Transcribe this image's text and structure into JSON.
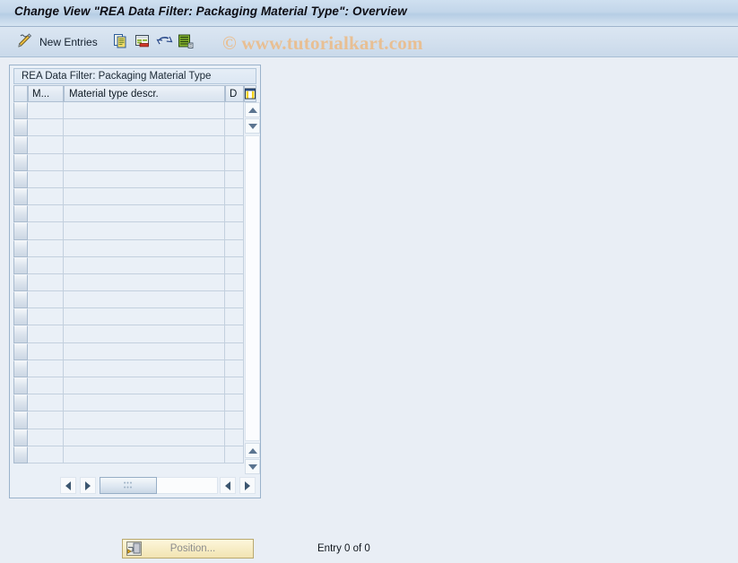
{
  "window": {
    "title": "Change View \"REA Data Filter: Packaging Material Type\": Overview"
  },
  "toolbar": {
    "edit_icon": "pencil-icon",
    "new_entries_label": "New Entries",
    "buttons": [
      {
        "name": "copy-as-button",
        "icon": "copy-icon"
      },
      {
        "name": "delete-button",
        "icon": "delete-row-icon"
      },
      {
        "name": "undo-button",
        "icon": "undo-icon"
      },
      {
        "name": "select-all-button",
        "icon": "details-icon"
      }
    ]
  },
  "watermark": {
    "text": "© www.tutorialkart.com",
    "color": "#e8bf93"
  },
  "panel": {
    "caption": "REA Data Filter: Packaging Material Type"
  },
  "grid": {
    "columns": [
      {
        "key": "gutter",
        "label": ""
      },
      {
        "key": "mtype",
        "label": "M..."
      },
      {
        "key": "descr",
        "label": "Material type descr."
      },
      {
        "key": "d",
        "label": "D"
      }
    ],
    "config_icon": "column-config-icon",
    "row_count": 21,
    "rows": []
  },
  "scrollbars": {
    "vertical_up_icon": "triangle-up-icon",
    "vertical_down_icon": "triangle-down-icon",
    "horizontal_left_icon": "triangle-left-icon",
    "horizontal_right_icon": "triangle-right-icon",
    "thumb_grip": "⋯"
  },
  "footer": {
    "position_label": "Position...",
    "position_icon": "position-icon",
    "entry_status": "Entry 0 of 0"
  },
  "colors": {
    "title_bar": "#c3d6ea",
    "toolbar": "#d3e0ee",
    "page_background": "#e9eef5",
    "grid_cell": "#eaf0f7",
    "grid_line": "#c3d0de",
    "panel_border": "#9ab2cb",
    "button_yellow": "#f7edc6"
  }
}
